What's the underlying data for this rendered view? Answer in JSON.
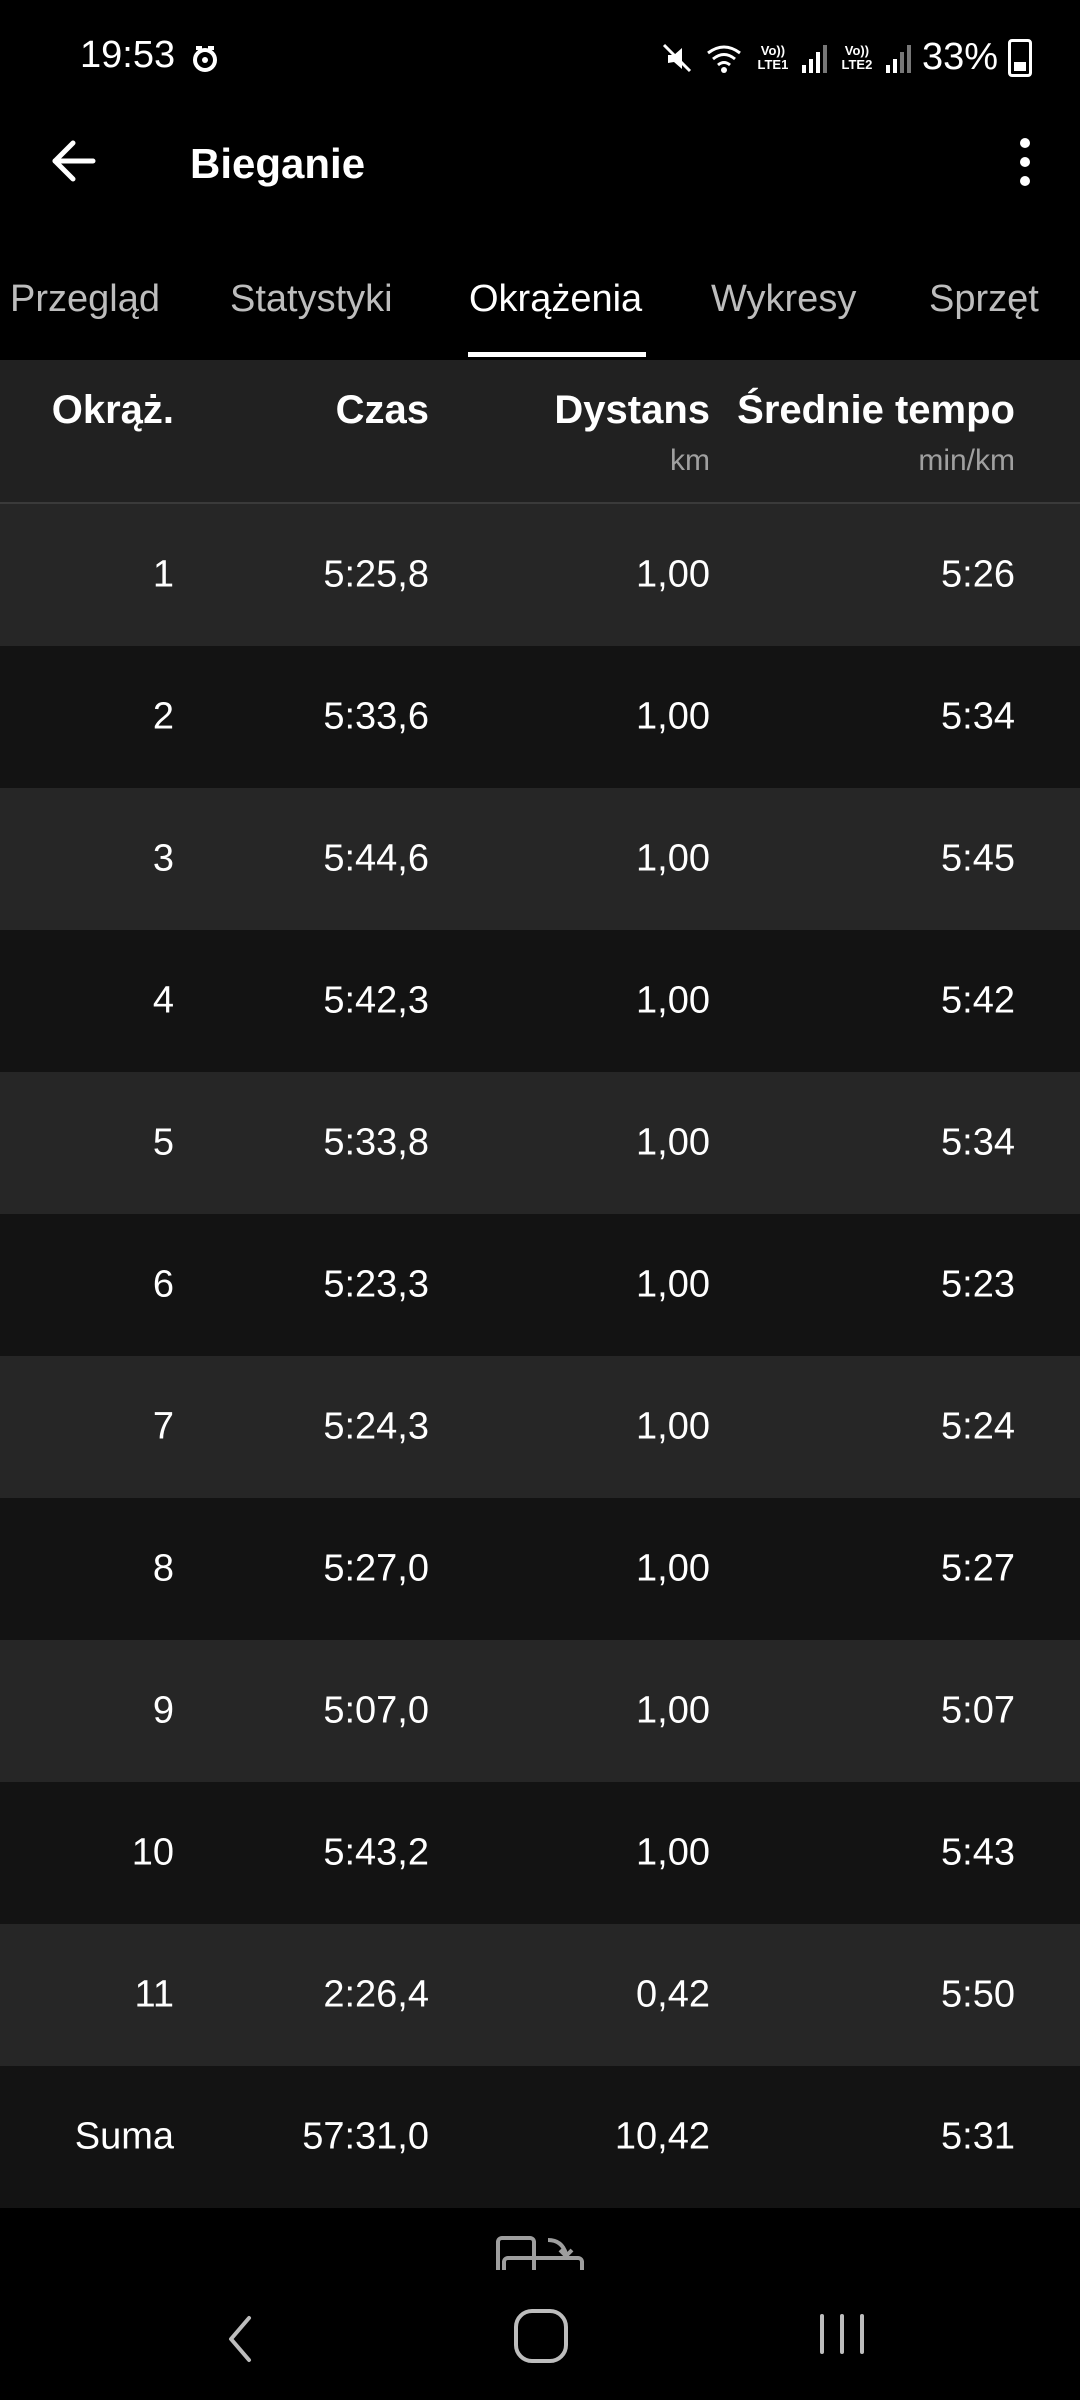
{
  "status_bar": {
    "time": "19:53",
    "signal1": "Vo)) LTE1",
    "signal2": "Vo)) LTE2",
    "battery": "33%"
  },
  "app_bar": {
    "title": "Bieganie",
    "back_icon": "arrow-left-icon",
    "menu_icon": "more-vertical-icon"
  },
  "tabs": [
    {
      "label": "Przegląd",
      "active": false
    },
    {
      "label": "Statystyki",
      "active": false
    },
    {
      "label": "Okrążenia",
      "active": true
    },
    {
      "label": "Wykresy",
      "active": false
    },
    {
      "label": "Sprzęt",
      "active": false
    }
  ],
  "table": {
    "headers": [
      {
        "label": "Okrąż.",
        "unit": ""
      },
      {
        "label": "Czas",
        "unit": ""
      },
      {
        "label": "Dystans",
        "unit": "km"
      },
      {
        "label": "Średnie tempo",
        "unit": "min/km"
      }
    ],
    "rows": [
      [
        "1",
        "5:25,8",
        "1,00",
        "5:26"
      ],
      [
        "2",
        "5:33,6",
        "1,00",
        "5:34"
      ],
      [
        "3",
        "5:44,6",
        "1,00",
        "5:45"
      ],
      [
        "4",
        "5:42,3",
        "1,00",
        "5:42"
      ],
      [
        "5",
        "5:33,8",
        "1,00",
        "5:34"
      ],
      [
        "6",
        "5:23,3",
        "1,00",
        "5:23"
      ],
      [
        "7",
        "5:24,3",
        "1,00",
        "5:24"
      ],
      [
        "8",
        "5:27,0",
        "1,00",
        "5:27"
      ],
      [
        "9",
        "5:07,0",
        "1,00",
        "5:07"
      ],
      [
        "10",
        "5:43,2",
        "1,00",
        "5:43"
      ],
      [
        "11",
        "2:26,4",
        "0,42",
        "5:50"
      ]
    ],
    "total": [
      "Suma",
      "57:31,0",
      "10,42",
      "5:31"
    ]
  },
  "footer_icon": "rotate-screen-icon",
  "colors": {
    "background": "#000000",
    "row_light": "#262626",
    "row_dark": "#131313",
    "header_bg": "#212121",
    "text": "#ffffff",
    "muted": "#a0a0a0"
  }
}
